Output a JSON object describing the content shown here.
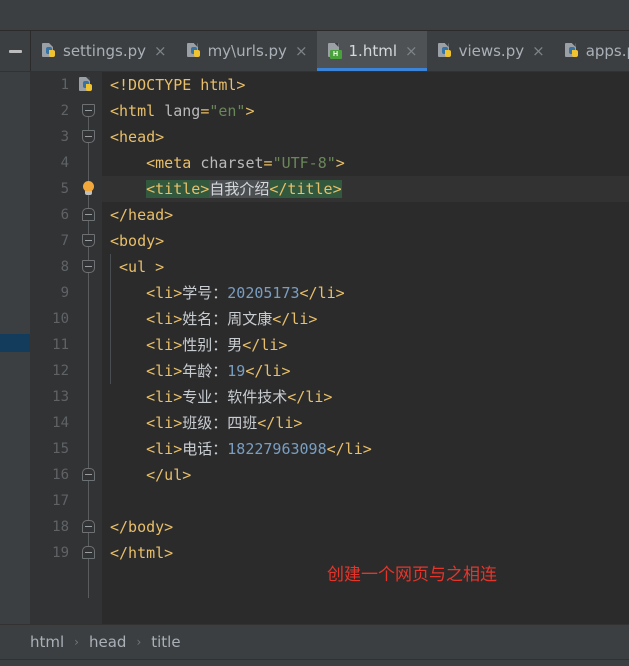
{
  "window": {
    "minimize_label": "—"
  },
  "tabs": [
    {
      "label": "settings.py",
      "icon": "python-file-icon",
      "active": false,
      "close": "×"
    },
    {
      "label": "my\\urls.py",
      "icon": "python-file-icon",
      "active": false,
      "close": "×"
    },
    {
      "label": "1.html",
      "icon": "html-file-icon",
      "active": true,
      "close": "×"
    },
    {
      "label": "views.py",
      "icon": "python-file-icon",
      "active": false,
      "close": "×"
    },
    {
      "label": "apps.py",
      "icon": "python-file-icon",
      "active": false,
      "close": "×"
    }
  ],
  "editor": {
    "gutter_icons": {
      "line1": "python-file-icon",
      "line5": "intention-bulb-icon"
    },
    "line_numbers": [
      1,
      2,
      3,
      4,
      5,
      6,
      7,
      8,
      9,
      10,
      11,
      12,
      13,
      14,
      15,
      16,
      17,
      18,
      19
    ],
    "lines": [
      {
        "n": 1,
        "segments": [
          {
            "t": "<!DOCTYPE html>",
            "c": "tag"
          }
        ]
      },
      {
        "n": 2,
        "segments": [
          {
            "t": "<html ",
            "c": "tag"
          },
          {
            "t": "lang",
            "c": "attr"
          },
          {
            "t": "=",
            "c": "tag"
          },
          {
            "t": "\"en\"",
            "c": "val"
          },
          {
            "t": ">",
            "c": "tag"
          }
        ]
      },
      {
        "n": 3,
        "segments": [
          {
            "t": "<head>",
            "c": "tag"
          }
        ]
      },
      {
        "n": 4,
        "segments": [
          {
            "t": "    <meta ",
            "c": "tag"
          },
          {
            "t": "charset",
            "c": "attr"
          },
          {
            "t": "=",
            "c": "tag"
          },
          {
            "t": "\"UTF-8\"",
            "c": "val"
          },
          {
            "t": ">",
            "c": "tag"
          }
        ]
      },
      {
        "n": 5,
        "segments": [
          {
            "t": "    ",
            "c": "tag"
          },
          {
            "t": "<title>",
            "c": "sel-tag"
          },
          {
            "t": "自我介绍",
            "c": "sel-text"
          },
          {
            "t": "</title>",
            "c": "sel-tag"
          }
        ]
      },
      {
        "n": 6,
        "segments": [
          {
            "t": "</head>",
            "c": "tag"
          }
        ]
      },
      {
        "n": 7,
        "segments": [
          {
            "t": "<body>",
            "c": "tag"
          }
        ]
      },
      {
        "n": 8,
        "segments": [
          {
            "t": " <ul >",
            "c": "tag"
          }
        ]
      },
      {
        "n": 9,
        "segments": [
          {
            "t": "    <li>",
            "c": "tag"
          },
          {
            "t": "学号：",
            "c": "txt"
          },
          {
            "t": "20205173",
            "c": "num"
          },
          {
            "t": "</li>",
            "c": "tag"
          }
        ]
      },
      {
        "n": 10,
        "segments": [
          {
            "t": "    <li>",
            "c": "tag"
          },
          {
            "t": "姓名：周文康",
            "c": "txt"
          },
          {
            "t": "</li>",
            "c": "tag"
          }
        ]
      },
      {
        "n": 11,
        "segments": [
          {
            "t": "    <li>",
            "c": "tag"
          },
          {
            "t": "性别：男",
            "c": "txt"
          },
          {
            "t": "</li>",
            "c": "tag"
          }
        ]
      },
      {
        "n": 12,
        "segments": [
          {
            "t": "    <li>",
            "c": "tag"
          },
          {
            "t": "年龄：",
            "c": "txt"
          },
          {
            "t": "19",
            "c": "num"
          },
          {
            "t": "</li>",
            "c": "tag"
          }
        ]
      },
      {
        "n": 13,
        "segments": [
          {
            "t": "    <li>",
            "c": "tag"
          },
          {
            "t": "专业：软件技术",
            "c": "txt"
          },
          {
            "t": "</li>",
            "c": "tag"
          }
        ]
      },
      {
        "n": 14,
        "segments": [
          {
            "t": "    <li>",
            "c": "tag"
          },
          {
            "t": "班级：四班",
            "c": "txt"
          },
          {
            "t": "</li>",
            "c": "tag"
          }
        ]
      },
      {
        "n": 15,
        "segments": [
          {
            "t": "    <li>",
            "c": "tag"
          },
          {
            "t": "电话：",
            "c": "txt"
          },
          {
            "t": "18227963098",
            "c": "num"
          },
          {
            "t": "</li>",
            "c": "tag"
          }
        ]
      },
      {
        "n": 16,
        "segments": [
          {
            "t": "    </ul>",
            "c": "tag"
          }
        ]
      },
      {
        "n": 17,
        "segments": [
          {
            "t": "",
            "c": "tag"
          }
        ]
      },
      {
        "n": 18,
        "segments": [
          {
            "t": "</body>",
            "c": "tag"
          }
        ]
      },
      {
        "n": 19,
        "segments": [
          {
            "t": "</html>",
            "c": "tag"
          }
        ]
      }
    ],
    "annotation": {
      "text": "创建一个网页与之相连",
      "color": "#e5352b"
    }
  },
  "breadcrumb": {
    "items": [
      "html",
      "head",
      "title"
    ],
    "separator": "›"
  },
  "colors": {
    "accent": "#3c84d8",
    "tag": "#e8bf6a",
    "attr_value": "#6a8759",
    "number": "#7a9ec2",
    "selection": "#32593d",
    "annotation": "#e5352b"
  }
}
